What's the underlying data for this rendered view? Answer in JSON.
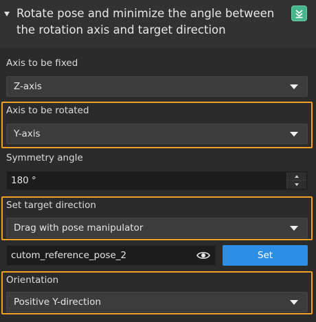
{
  "header": {
    "title": "Rotate pose and minimize the angle between the rotation axis and target direction",
    "collapse_icon": "double-chevron-down-icon",
    "accent_color": "#47b58b"
  },
  "fields": {
    "axis_fixed": {
      "label": "Axis to be fixed",
      "value": "Z-axis"
    },
    "axis_rotated": {
      "label": "Axis to be rotated",
      "value": "Y-axis"
    },
    "symmetry_angle": {
      "label": "Symmetry angle",
      "value": "180 °"
    },
    "target_direction": {
      "label": "Set target direction",
      "value": "Drag with pose manipulator"
    },
    "reference_pose": {
      "value": "cutom_reference_pose_2",
      "icon": "eye-icon",
      "button": "Set"
    },
    "orientation": {
      "label": "Orientation",
      "value": "Positive Y-direction"
    }
  },
  "colors": {
    "highlight": "#f0a022",
    "button": "#2d8ee6",
    "background": "#2b2b2b"
  }
}
